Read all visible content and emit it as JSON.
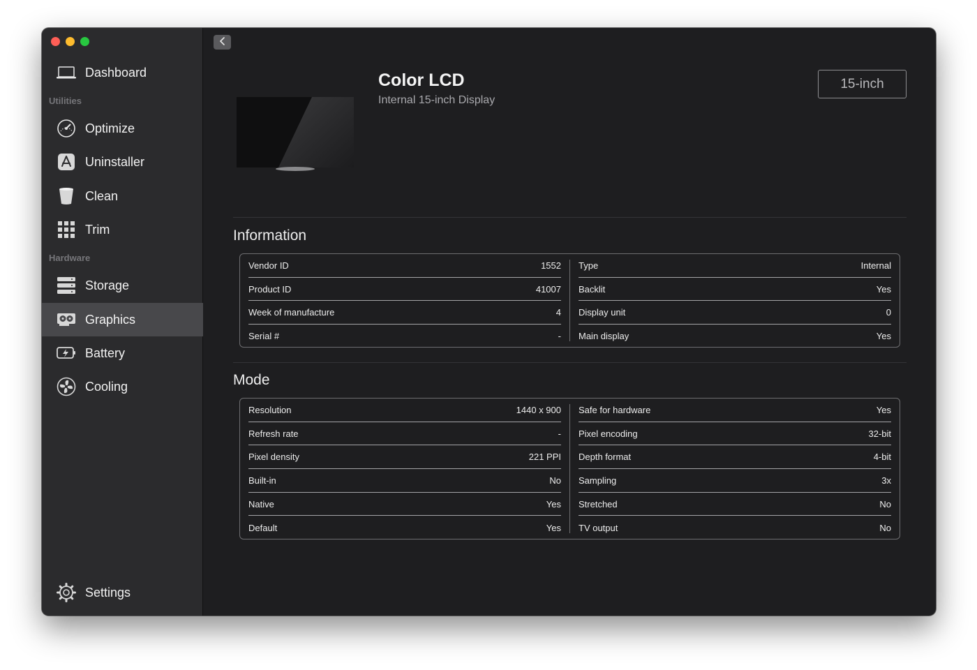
{
  "sidebar": {
    "items": [
      {
        "label": "Dashboard",
        "icon": "laptop-icon"
      },
      {
        "label": "Optimize",
        "icon": "speedometer-icon"
      },
      {
        "label": "Uninstaller",
        "icon": "app-store-icon"
      },
      {
        "label": "Clean",
        "icon": "trash-bin-icon"
      },
      {
        "label": "Trim",
        "icon": "grid-icon"
      },
      {
        "label": "Storage",
        "icon": "server-icon"
      },
      {
        "label": "Graphics",
        "icon": "graphics-card-icon"
      },
      {
        "label": "Battery",
        "icon": "battery-icon"
      },
      {
        "label": "Cooling",
        "icon": "fan-icon"
      },
      {
        "label": "Settings",
        "icon": "gear-icon"
      }
    ],
    "sections": {
      "utilities": "Utilities",
      "hardware": "Hardware"
    },
    "active": "Graphics"
  },
  "header": {
    "title": "Color LCD",
    "subtitle": "Internal 15-inch Display",
    "size_button": "15-inch"
  },
  "information": {
    "title": "Information",
    "left": [
      {
        "label": "Vendor ID",
        "value": "1552"
      },
      {
        "label": "Product ID",
        "value": "41007"
      },
      {
        "label": "Week of manufacture",
        "value": "4"
      },
      {
        "label": "Serial #",
        "value": "-"
      }
    ],
    "right": [
      {
        "label": "Type",
        "value": "Internal"
      },
      {
        "label": "Backlit",
        "value": "Yes"
      },
      {
        "label": "Display unit",
        "value": "0"
      },
      {
        "label": "Main display",
        "value": "Yes"
      }
    ]
  },
  "mode": {
    "title": "Mode",
    "left": [
      {
        "label": "Resolution",
        "value": "1440 x 900"
      },
      {
        "label": "Refresh rate",
        "value": "-"
      },
      {
        "label": "Pixel density",
        "value": "221 PPI"
      },
      {
        "label": "Built-in",
        "value": "No"
      },
      {
        "label": "Native",
        "value": "Yes"
      },
      {
        "label": "Default",
        "value": "Yes"
      }
    ],
    "right": [
      {
        "label": "Safe for hardware",
        "value": "Yes"
      },
      {
        "label": "Pixel encoding",
        "value": "32-bit"
      },
      {
        "label": "Depth format",
        "value": "4-bit"
      },
      {
        "label": "Sampling",
        "value": "3x"
      },
      {
        "label": "Stretched",
        "value": "No"
      },
      {
        "label": "TV output",
        "value": "No"
      }
    ]
  },
  "colors": {
    "accent_red": "#ff5f57",
    "accent_yellow": "#febc2e",
    "accent_green": "#28c840"
  }
}
